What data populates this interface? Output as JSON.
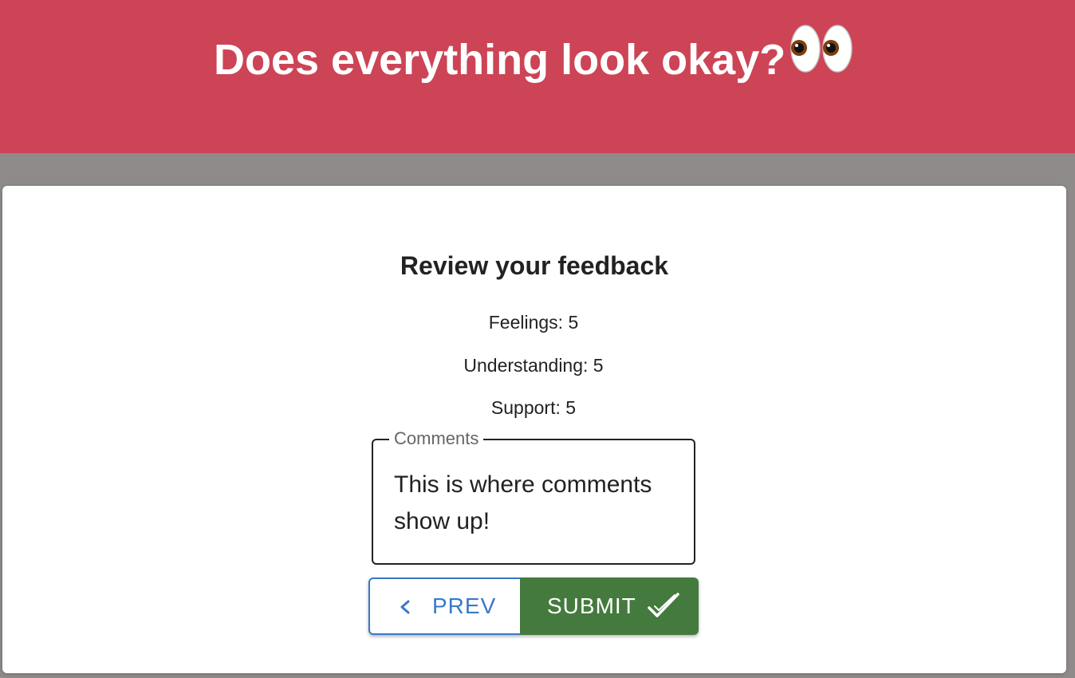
{
  "header": {
    "title": "Does everything look okay?",
    "emoji_icon": "eyes-emoji-icon",
    "background_color": "#cc4455"
  },
  "review": {
    "title": "Review your feedback",
    "feelings": "Feelings: 5",
    "understanding": "Understanding: 5",
    "support": "Support: 5"
  },
  "comments": {
    "label": "Comments",
    "value": "This is where comments show up!"
  },
  "buttons": {
    "prev_label": "PREV",
    "prev_icon": "chevron-left-icon",
    "prev_color": "#3a78c9",
    "submit_label": "SUBMIT",
    "submit_icon": "double-check-icon",
    "submit_color": "#447a3d"
  }
}
